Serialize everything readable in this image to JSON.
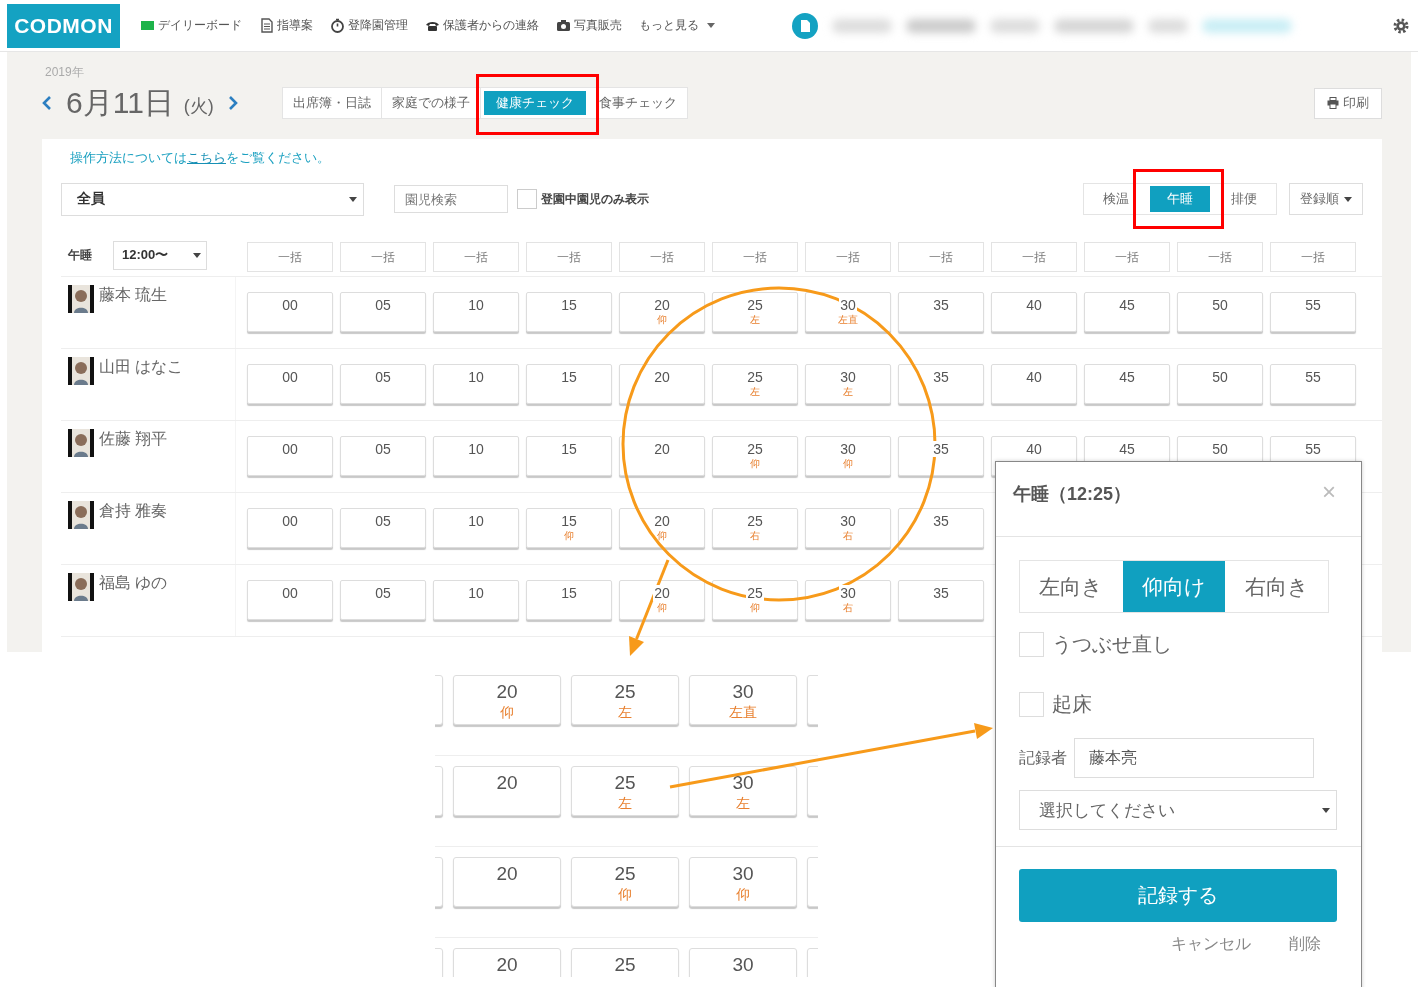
{
  "nav": {
    "logo": "CODMON",
    "items": [
      "デイリーボード",
      "指導案",
      "登降園管理",
      "保護者からの連絡",
      "写真販売"
    ],
    "more": "もっと見る"
  },
  "date": {
    "year": "2019年",
    "day": "6月11日",
    "weekday": "(火)"
  },
  "tabs": [
    {
      "label": "出席簿・日誌",
      "selected": false
    },
    {
      "label": "家庭での様子",
      "selected": false
    },
    {
      "label": "健康チェック",
      "selected": true
    },
    {
      "label": "食事チェック",
      "selected": false
    }
  ],
  "print": "印刷",
  "instruction": {
    "before": "操作方法については",
    "link": "こちら",
    "after": "をご覧ください。"
  },
  "filters": {
    "group": "全員",
    "search_placeholder": "園児検索",
    "present_only": {
      "label": "登園中園児のみ表示",
      "checked": false
    }
  },
  "categories": [
    {
      "label": "検温",
      "selected": false
    },
    {
      "label": "午睡",
      "selected": true
    },
    {
      "label": "排便",
      "selected": false
    }
  ],
  "sort": "登録順",
  "nap_header": {
    "label": "午睡",
    "time": "12:00〜",
    "bulk": [
      "一括",
      "一括",
      "一括",
      "一括",
      "一括",
      "一括",
      "一括",
      "一括",
      "一括",
      "一括",
      "一括",
      "一括"
    ]
  },
  "children": [
    {
      "name": "藤本 琉生",
      "cells": [
        {
          "time": "00"
        },
        {
          "time": "05"
        },
        {
          "time": "10"
        },
        {
          "time": "15"
        },
        {
          "time": "20",
          "mark": "仰"
        },
        {
          "time": "25",
          "mark": "左"
        },
        {
          "time": "30",
          "mark": "左直"
        },
        {
          "time": "35"
        },
        {
          "time": "40"
        },
        {
          "time": "45"
        },
        {
          "time": "50"
        },
        {
          "time": "55"
        }
      ]
    },
    {
      "name": "山田 はなこ",
      "cells": [
        {
          "time": "00"
        },
        {
          "time": "05"
        },
        {
          "time": "10"
        },
        {
          "time": "15"
        },
        {
          "time": "20"
        },
        {
          "time": "25",
          "mark": "左"
        },
        {
          "time": "30",
          "mark": "左"
        },
        {
          "time": "35"
        },
        {
          "time": "40"
        },
        {
          "time": "45"
        },
        {
          "time": "50"
        },
        {
          "time": "55"
        }
      ]
    },
    {
      "name": "佐藤 翔平",
      "cells": [
        {
          "time": "00"
        },
        {
          "time": "05"
        },
        {
          "time": "10"
        },
        {
          "time": "15"
        },
        {
          "time": "20"
        },
        {
          "time": "25",
          "mark": "仰"
        },
        {
          "time": "30",
          "mark": "仰"
        },
        {
          "time": "35"
        },
        {
          "time": "40"
        },
        {
          "time": "45"
        },
        {
          "time": "50"
        },
        {
          "time": "55"
        }
      ]
    },
    {
      "name": "倉持 雅奏",
      "cells": [
        {
          "time": "00"
        },
        {
          "time": "05"
        },
        {
          "time": "10"
        },
        {
          "time": "15",
          "mark": "仰"
        },
        {
          "time": "20",
          "mark": "仰"
        },
        {
          "time": "25",
          "mark": "右"
        },
        {
          "time": "30",
          "mark": "右"
        },
        {
          "time": "35"
        }
      ]
    },
    {
      "name": "福島 ゆの",
      "cells": [
        {
          "time": "00"
        },
        {
          "time": "05"
        },
        {
          "time": "10"
        },
        {
          "time": "15"
        },
        {
          "time": "20",
          "mark": "仰"
        },
        {
          "time": "25",
          "mark": "仰"
        },
        {
          "time": "30",
          "mark": "右"
        },
        {
          "time": "35"
        }
      ]
    }
  ],
  "zoom_inset": {
    "rows": [
      {
        "cells": [
          {
            "time": "20",
            "mark": "仰"
          },
          {
            "time": "25",
            "mark": "左"
          },
          {
            "time": "30",
            "mark": "左直"
          }
        ]
      },
      {
        "cells": [
          {
            "time": "20"
          },
          {
            "time": "25",
            "mark": "左"
          },
          {
            "time": "30",
            "mark": "左"
          }
        ]
      },
      {
        "cells": [
          {
            "time": "20"
          },
          {
            "time": "25",
            "mark": "仰"
          },
          {
            "time": "30",
            "mark": "仰"
          }
        ]
      },
      {
        "cells": [
          {
            "time": "20"
          },
          {
            "time": "25"
          },
          {
            "time": "30"
          }
        ]
      }
    ]
  },
  "popup": {
    "title": "午睡（12:25）",
    "close": "×",
    "positions": [
      {
        "label": "左向き",
        "selected": false
      },
      {
        "label": "仰向け",
        "selected": true
      },
      {
        "label": "右向き",
        "selected": false
      }
    ],
    "checks": [
      {
        "label": "うつぶせ直し",
        "checked": false
      },
      {
        "label": "起床",
        "checked": false
      }
    ],
    "recorder_label": "記録者",
    "recorder": "藤本亮",
    "select_placeholder": "選択してください",
    "submit": "記録する",
    "cancel": "キャンセル",
    "delete": "削除"
  }
}
